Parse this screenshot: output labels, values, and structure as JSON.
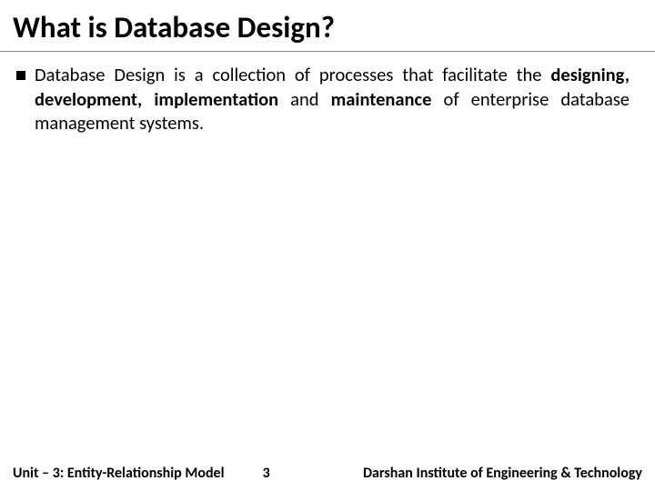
{
  "title": "What is Database Design?",
  "bullet": {
    "pre": "Database Design is a collection of processes that facilitate the ",
    "b1": "designing, development, implementation",
    "mid1": " and ",
    "b2": "maintenance",
    "post": " of enterprise database management systems."
  },
  "footer": {
    "left": "Unit – 3: Entity-Relationship Model",
    "center": "3",
    "right": "Darshan Institute of Engineering & Technology"
  }
}
